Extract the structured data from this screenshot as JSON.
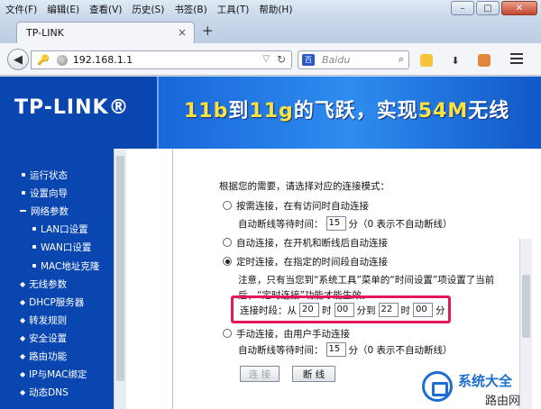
{
  "menubar": {
    "items": [
      "文件(F)",
      "编辑(E)",
      "查看(V)",
      "历史(S)",
      "书签(B)",
      "工具(T)",
      "帮助(H)"
    ],
    "minimize": "–",
    "maximize": "□",
    "close": "✕"
  },
  "tab": {
    "title": "TP-LINK",
    "close": "×",
    "new_tab": "+"
  },
  "navbar": {
    "url": "192.168.1.1",
    "search_placeholder": "Baidu",
    "search_engine": "百"
  },
  "banner": {
    "logo": "TP-LINK®",
    "slogan_parts": [
      "11b",
      "到",
      "11g",
      "的飞跃，实现",
      "54M",
      "无线"
    ]
  },
  "sidebar": {
    "items": [
      "运行状态",
      "设置向导",
      "网络参数",
      "LAN口设置",
      "WAN口设置",
      "MAC地址克隆",
      "无线参数",
      "DHCP服务器",
      "转发规则",
      "安全设置",
      "路由功能",
      "IP与MAC绑定",
      "动态DNS"
    ]
  },
  "form": {
    "intro": "根据您的需要，请选择对应的连接模式：",
    "on_demand": "按需连接，在有访问时自动连接",
    "idle_prefix1": "自动断线等待时间：",
    "idle_value1": "15",
    "idle_suffix1": "分（0 表示不自动断线）",
    "auto": "自动连接，在开机和断线后自动连接",
    "timed": "定时连接，在指定的时间段自动连接",
    "note1": "注意，只有当您到“系统工具”菜单的“时间设置”项设置了当前",
    "note2": "后，“定时连接”功能才能生效。",
    "period_label": "连接时段：从",
    "from_hour": "20",
    "hour_label1": "时",
    "from_min": "00",
    "to_label": "分到",
    "to_hour": "22",
    "hour_label2": "时",
    "to_min": "00",
    "min_label": "分",
    "manual": "手动连接，由用户手动连接",
    "idle_prefix2": "自动断线等待时间：",
    "idle_value2": "15",
    "idle_suffix2": "分（0 表示不自动断线）",
    "connect_btn": "连 接",
    "disconnect_btn": "断 线"
  },
  "watermark": {
    "brand": "系统大全",
    "sub": "路由网"
  },
  "colors": {
    "sidebar_bg": "#0a46b0",
    "highlight": "#e3175a",
    "slogan_accent": "#ffe23b"
  }
}
